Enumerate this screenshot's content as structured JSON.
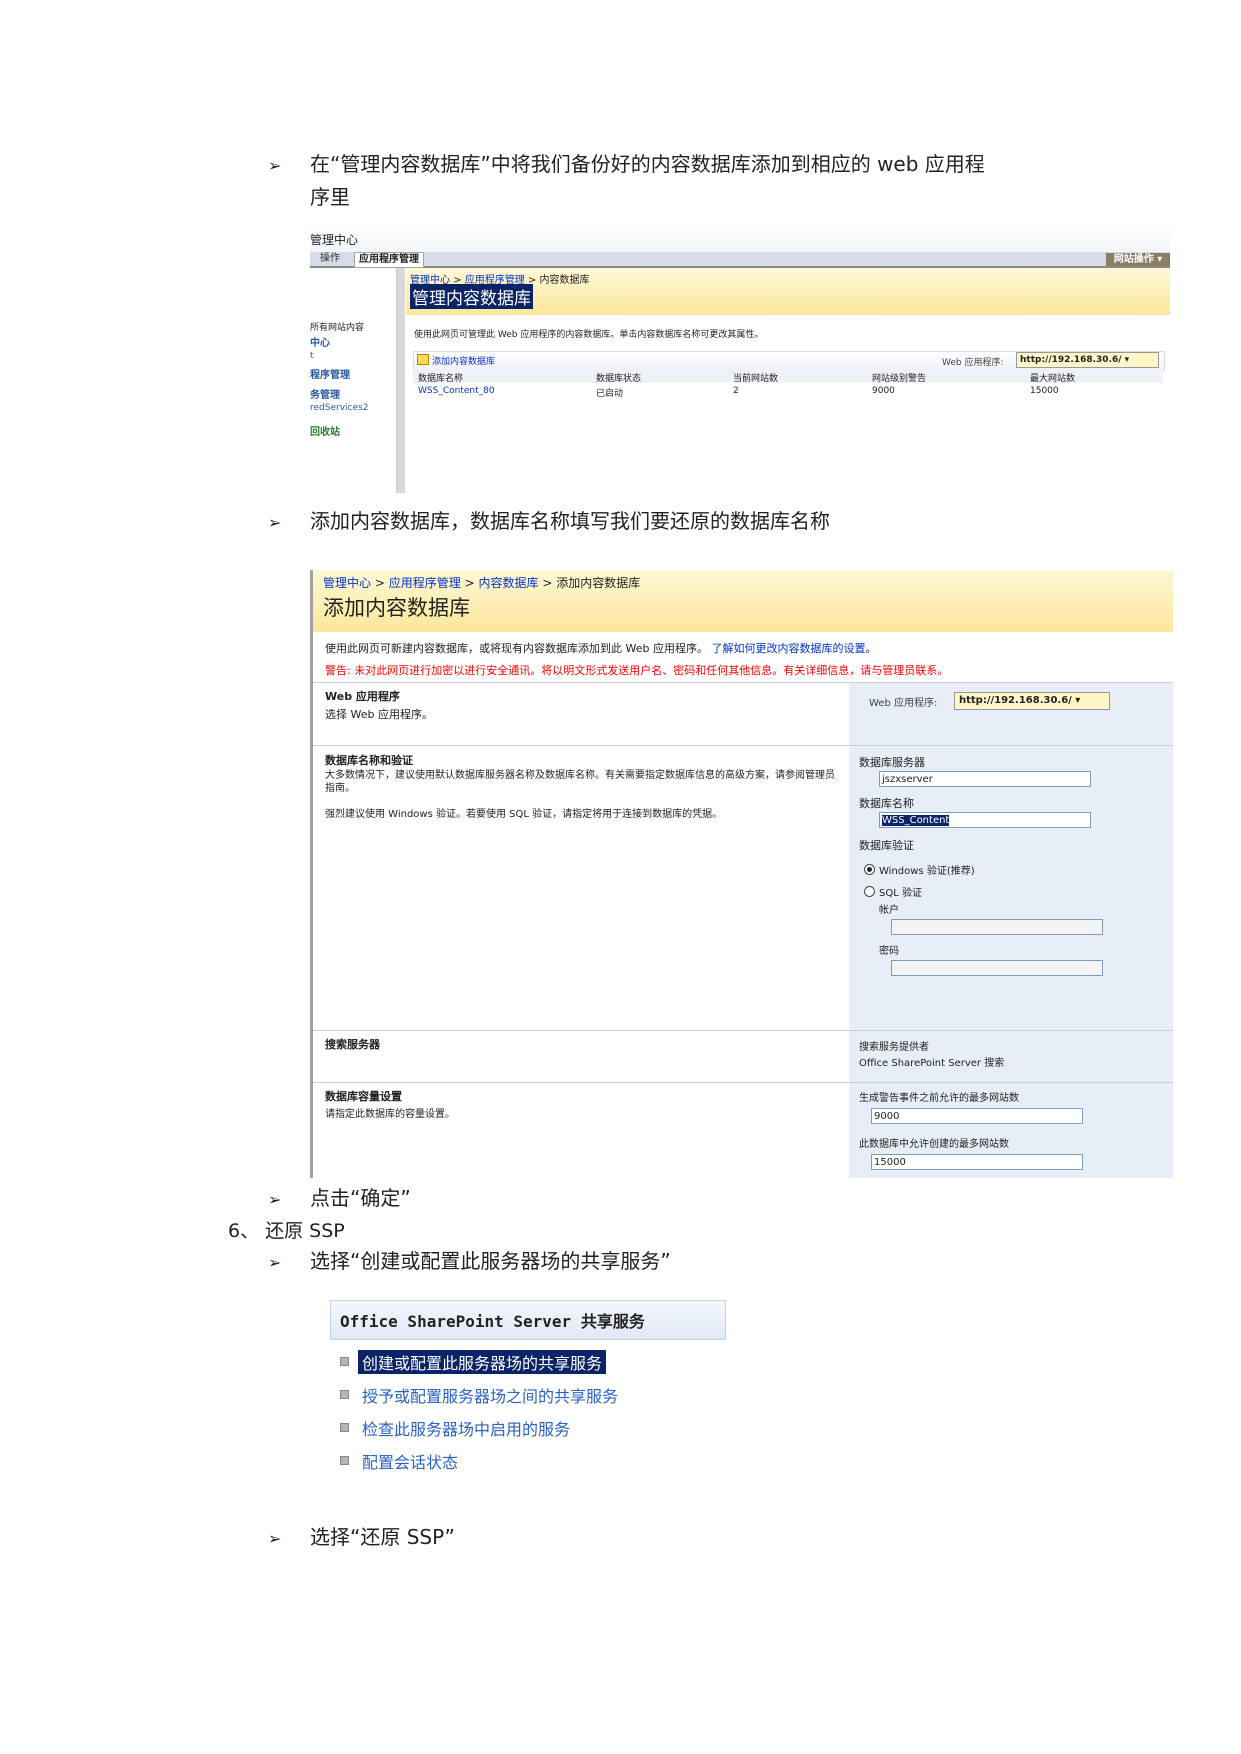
{
  "doc": {
    "bullet_glyph": "➢",
    "p1_line1": "在“管理内容数据库”中将我们备份好的内容数据库添加到相应的 web 应用程",
    "p1_line2": "序里",
    "p2": "添加内容数据库，数据库名称填写我们要还原的数据库名称",
    "p3": "点击“确定”",
    "step6": "6、 还原 SSP",
    "p4": "选择“创建或配置此服务器场的共享服务”",
    "p5": "选择“还原 SSP”"
  },
  "shot1": {
    "title": "管理中心",
    "tab_ops": "操作",
    "tab_app": "应用程序管理",
    "site_actions": "网站操作 ▾",
    "breadcrumb": [
      "管理中心",
      ">",
      "应用程序管理",
      ">",
      "内容数据库"
    ],
    "heading": "管理内容数据库",
    "nav": [
      "所有网站内容",
      "中心",
      "t",
      "程序管理",
      "务管理",
      "redServices2",
      "回收站"
    ],
    "desc": "使用此网页可管理此 Web 应用程序的内容数据库。单击内容数据库名称可更改其属性。",
    "add_link": "添加内容数据库",
    "webapp_label": "Web 应用程序:",
    "webapp_value": "http://192.168.30.6/ ▾",
    "columns": [
      "数据库名称",
      "数据库状态",
      "当前网站数",
      "网站级别警告",
      "最大网站数"
    ],
    "rows": [
      [
        "WSS_Content_80",
        "已启动",
        "2",
        "9000",
        "15000"
      ]
    ]
  },
  "shot2": {
    "breadcrumb": [
      "管理中心",
      ">",
      "应用程序管理",
      ">",
      "内容数据库",
      ">",
      "添加内容数据库"
    ],
    "heading": "添加内容数据库",
    "desc": "使用此网页可新建内容数据库，或将现有内容数据库添加到此 Web 应用程序。",
    "desc_link": "了解如何更改内容数据库的设置。",
    "warning": "警告: 未对此网页进行加密以进行安全通讯。将以明文形式发送用户名、密码和任何其他信息。有关详细信息，请与管理员联系。",
    "sec1_title": "Web 应用程序",
    "sec1_desc": "选择 Web 应用程序。",
    "sec1_label": "Web 应用程序:",
    "sec1_value": "http://192.168.30.6/ ▾",
    "sec2_title": "数据库名称和验证",
    "sec2_desc1": "大多数情况下，建议使用默认数据库服务器名称及数据库名称。有关需要指定数据库信息的高级方案，请参阅管理员指南。",
    "sec2_desc2": "强烈建议使用 Windows 验证。若要使用 SQL 验证，请指定将用于连接到数据库的凭据。",
    "db_server_label": "数据库服务器",
    "db_server_value": "jszxserver",
    "db_name_label": "数据库名称",
    "db_name_value": "WSS_Content",
    "db_auth_label": "数据库验证",
    "auth_windows": "Windows 验证(推荐)",
    "auth_sql": "SQL 验证",
    "account_label": "帐户",
    "password_label": "密码",
    "sec3_title": "搜索服务器",
    "sec3_label": "搜索服务提供者",
    "sec3_value": "Office SharePoint Server 搜索",
    "sec4_title": "数据库容量设置",
    "sec4_desc": "请指定此数据库的容量设置。",
    "warn_sites_label": "生成警告事件之前允许的最多网站数",
    "warn_sites_value": "9000",
    "max_sites_label": "此数据库中允许创建的最多网站数",
    "max_sites_value": "15000"
  },
  "shot3": {
    "header": "Office SharePoint Server 共享服务",
    "items": [
      "创建或配置此服务器场的共享服务",
      "授予或配置服务器场之间的共享服务",
      "检查此服务器场中启用的服务",
      "配置会话状态"
    ]
  },
  "colors": {
    "sp_yellow": "#fbe79a",
    "sp_panel": "#e8eef7",
    "link_blue": "#0033cc",
    "warning_red": "#ff0000",
    "highlight_navy": "#0a2467"
  }
}
